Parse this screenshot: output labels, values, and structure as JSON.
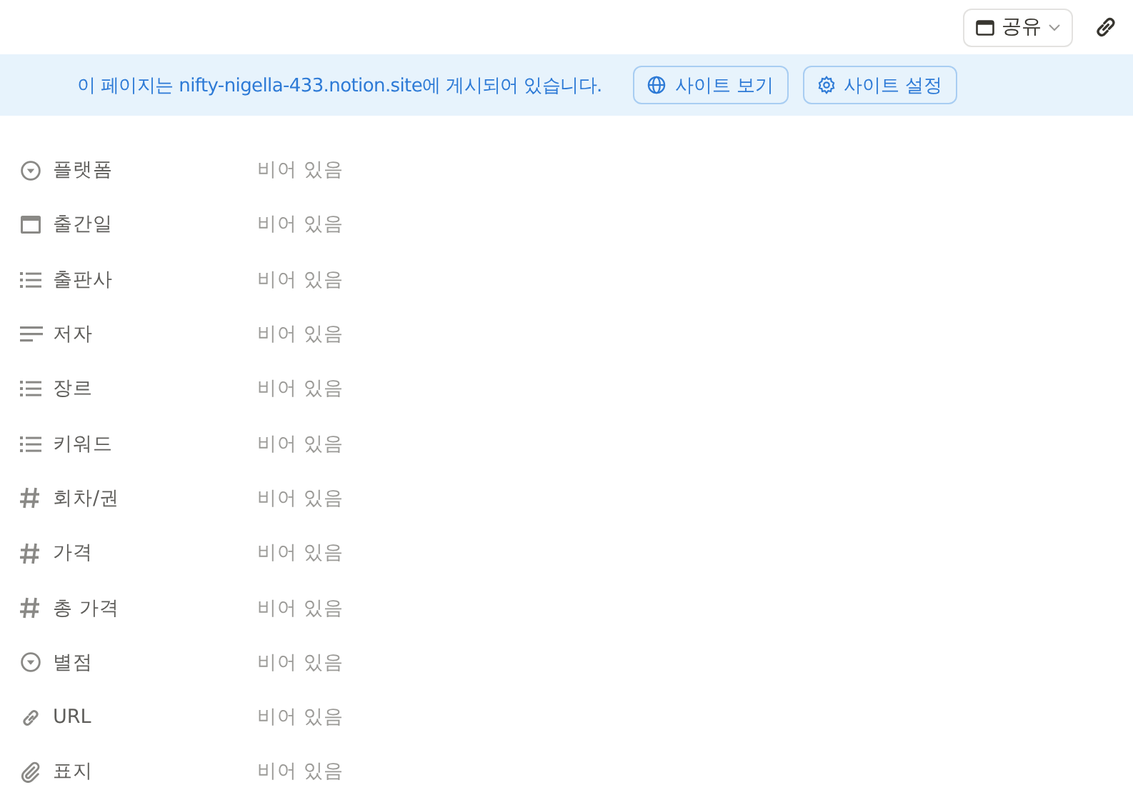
{
  "topbar": {
    "share_label": "공유"
  },
  "banner": {
    "message": "이 페이지는 nifty-nigella-433.notion.site에 게시되어 있습니다.",
    "buttons": [
      {
        "kind": "view",
        "label": "사이트 보기"
      },
      {
        "kind": "settings",
        "label": "사이트 설정"
      }
    ]
  },
  "properties": [
    {
      "kind": "select",
      "name": "플랫폼",
      "value": "비어 있음"
    },
    {
      "kind": "date",
      "name": "출간일",
      "value": "비어 있음"
    },
    {
      "kind": "multi_select",
      "name": "출판사",
      "value": "비어 있음"
    },
    {
      "kind": "text",
      "name": "저자",
      "value": "비어 있음"
    },
    {
      "kind": "multi_select",
      "name": "장르",
      "value": "비어 있음"
    },
    {
      "kind": "multi_select",
      "name": "키워드",
      "value": "비어 있음"
    },
    {
      "kind": "number",
      "name": "회차/권",
      "value": "비어 있음"
    },
    {
      "kind": "number",
      "name": "가격",
      "value": "비어 있음"
    },
    {
      "kind": "number",
      "name": "총 가격",
      "value": "비어 있음"
    },
    {
      "kind": "select",
      "name": "별점",
      "value": "비어 있음"
    },
    {
      "kind": "url",
      "name": "URL",
      "value": "비어 있음"
    },
    {
      "kind": "file",
      "name": "표지",
      "value": "비어 있음"
    }
  ]
}
